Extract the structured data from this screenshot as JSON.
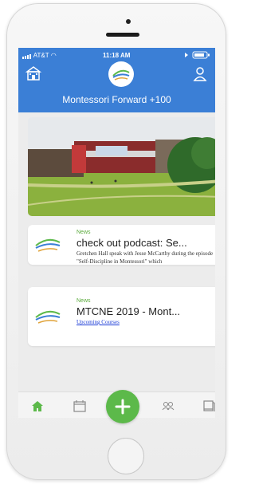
{
  "status_bar": {
    "carrier": "AT&T",
    "time": "11:18 AM"
  },
  "header": {
    "title": "Montessori Forward +100"
  },
  "feed": [
    {
      "category": "News",
      "headline": "check out podcast: Se...",
      "excerpt": "Gretchen Hall speak with Jesse McCarthy during the episode \"Self-Discipline in Montessori\" which"
    },
    {
      "category": "News",
      "headline": "MTCNE 2019 - Mont...",
      "link_text": "Upcoming Courses"
    }
  ],
  "tabs": [
    "home-icon",
    "calendar-icon",
    "add-icon",
    "people-icon",
    "book-icon"
  ],
  "colors": {
    "header_blue": "#3b7fd6",
    "accent_green": "#5cb94a",
    "link_blue": "#1a3bd6"
  }
}
